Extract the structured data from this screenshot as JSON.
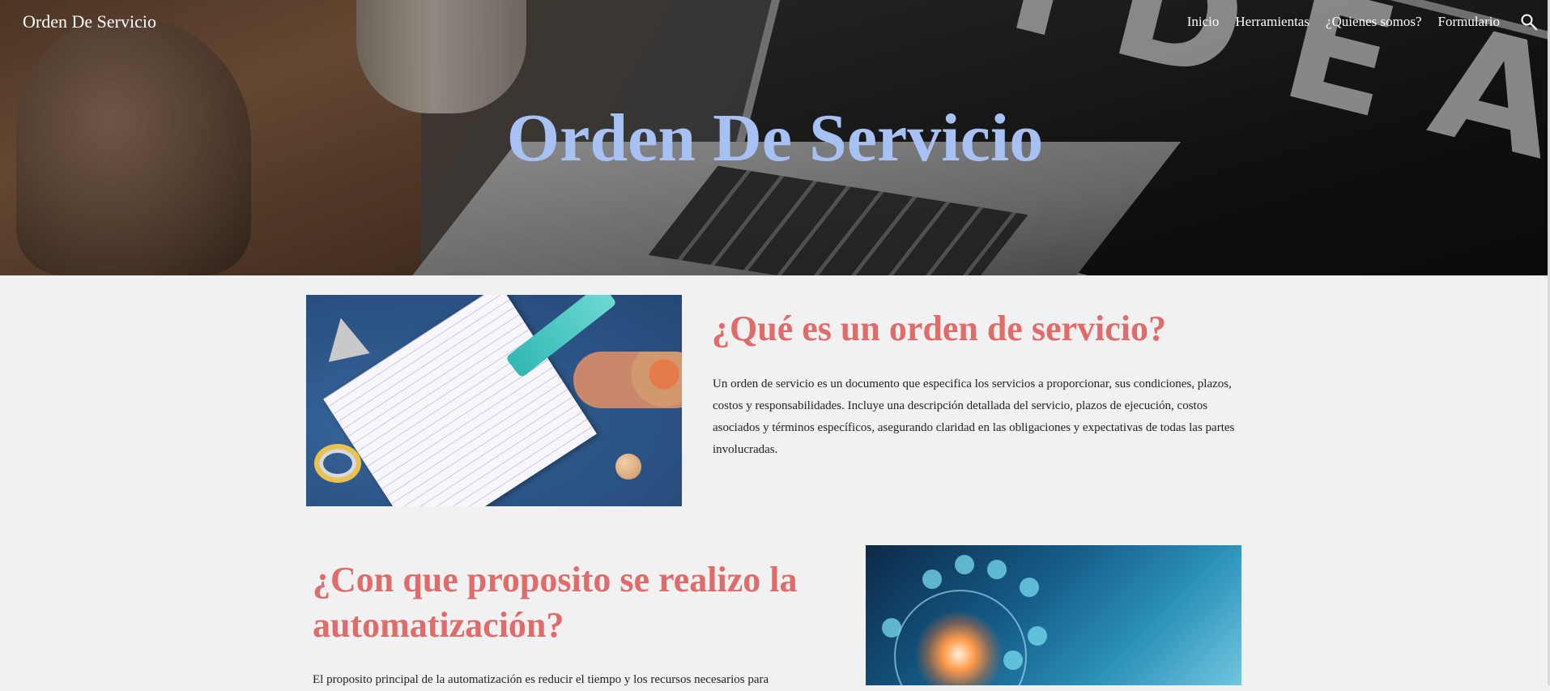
{
  "header": {
    "site_title": "Orden De Servicio",
    "nav": [
      {
        "label": "Inicio"
      },
      {
        "label": "Herramientas"
      },
      {
        "label": "¿Quienes somos?"
      },
      {
        "label": "Formulario"
      }
    ],
    "search_icon": "search-icon"
  },
  "hero": {
    "title": "Orden De Servicio",
    "title_color": "#a7c1f4",
    "background_text": "IDEAS"
  },
  "sections": [
    {
      "heading": "¿Qué es un orden de servicio?",
      "body": "Un orden de servicio es un documento que especifica los servicios a proporcionar, sus condiciones, plazos, costos y responsabilidades. Incluye una descripción detallada del servicio, plazos de ejecución, costos asociados y términos específicos, asegurando claridad en las obligaciones y expectativas de todas las partes involucradas.",
      "image": "notepad-drawing-image"
    },
    {
      "heading": "¿Con que proposito se realizo la automatización?",
      "body": "El proposito principal de la automatización es reducir el tiempo y los recursos necesarios para",
      "image": "technology-network-image"
    }
  ],
  "colors": {
    "heading": "#e06b6b",
    "background": "#f1f1f1"
  }
}
